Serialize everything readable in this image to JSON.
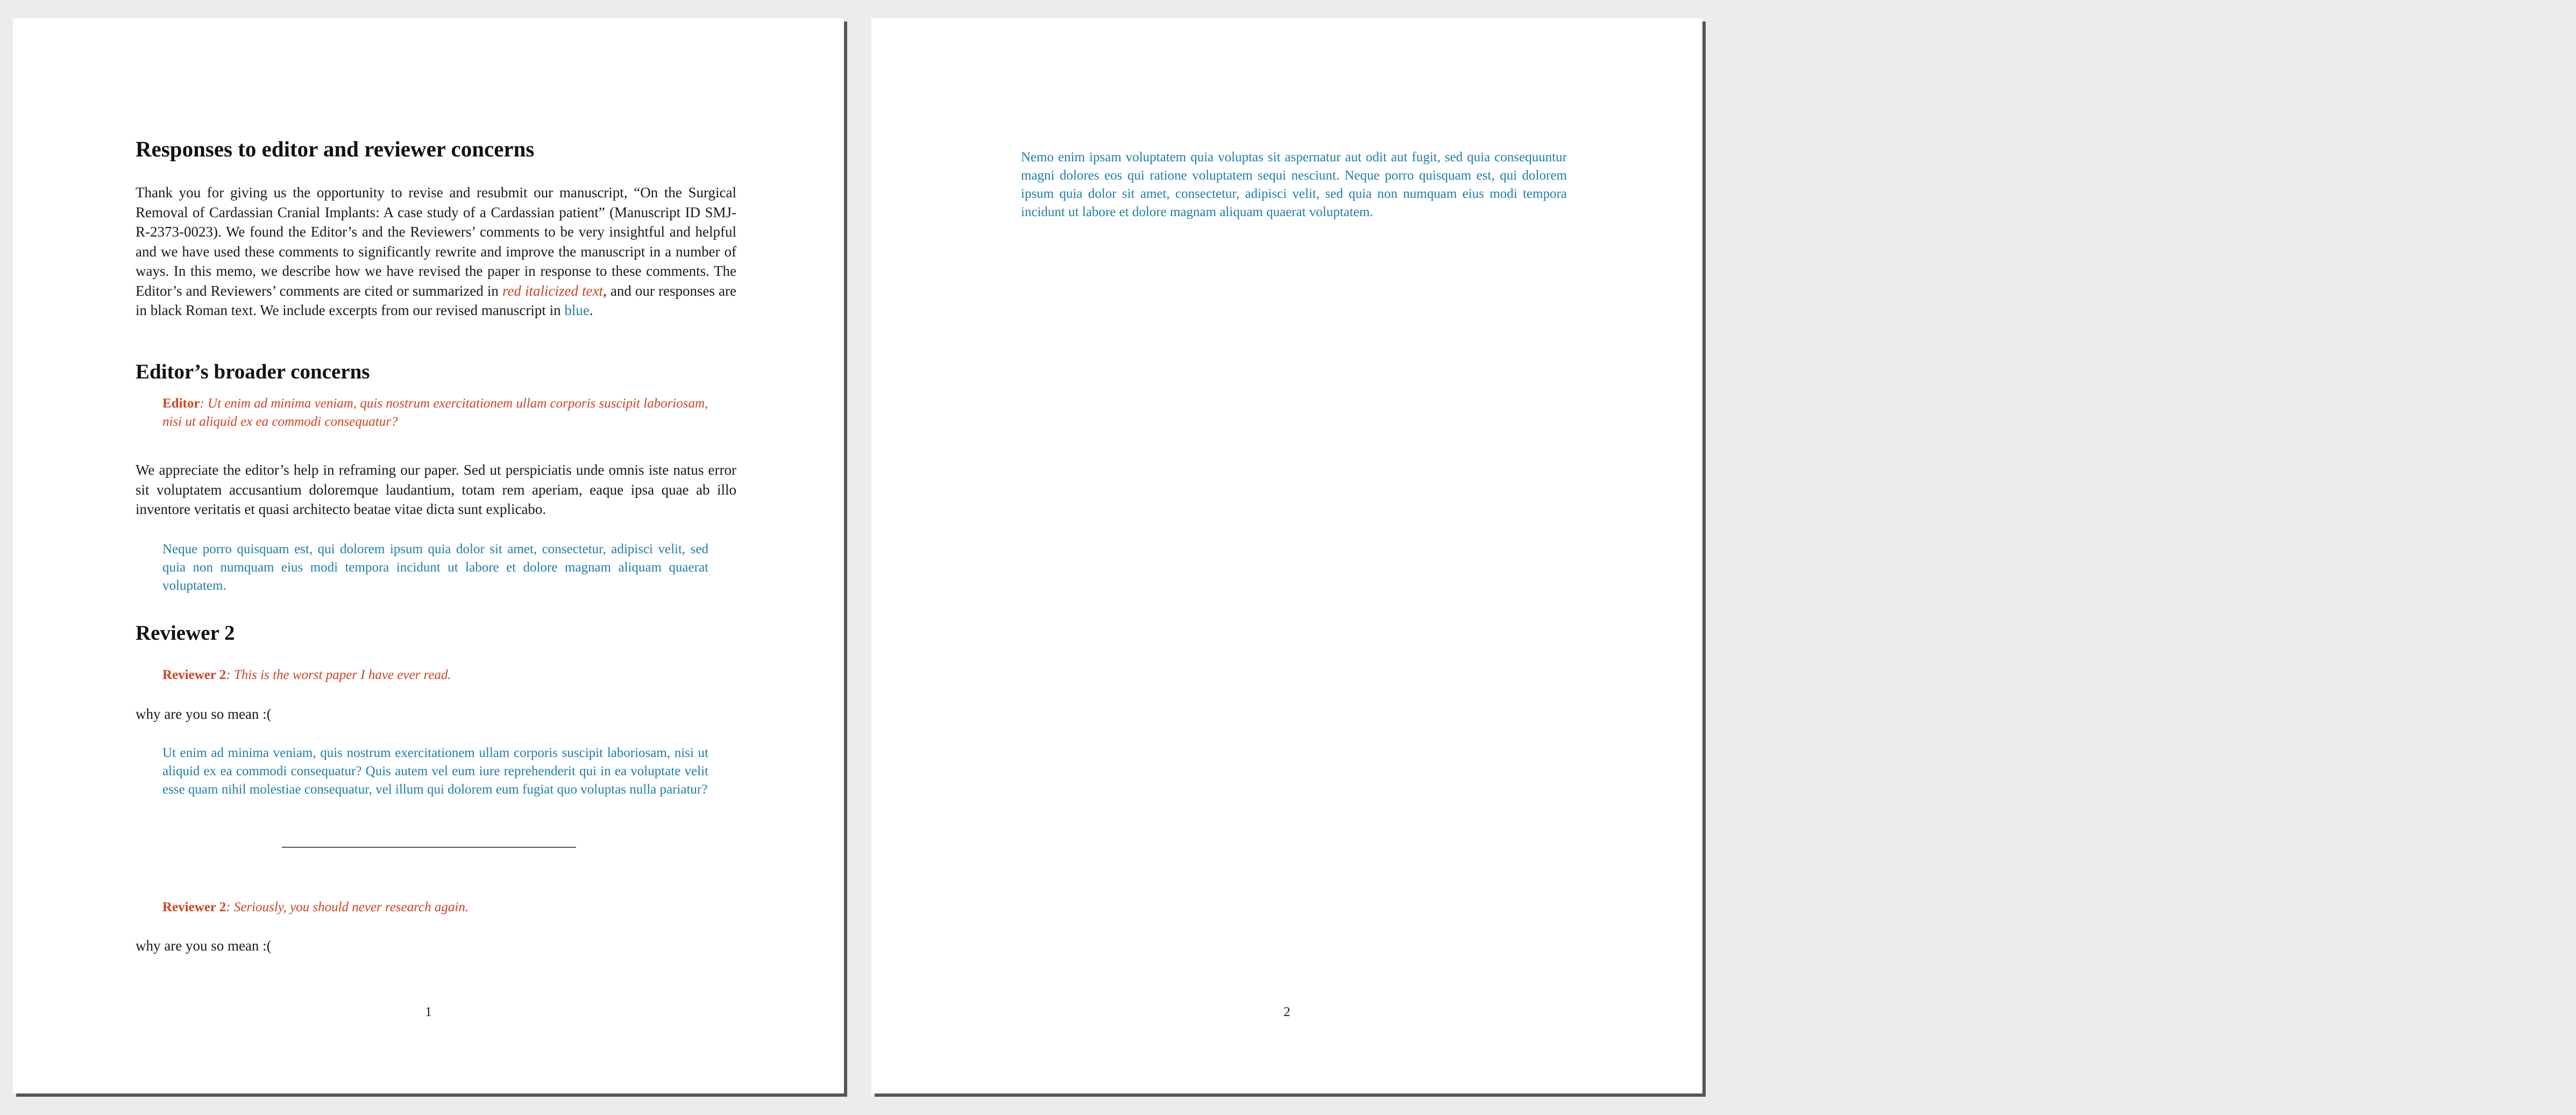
{
  "page1": {
    "title": "Responses to editor and reviewer concerns",
    "intro": {
      "part1": "Thank you for giving us the opportunity to revise and resubmit our manuscript, “On the Surgical Removal of Cardassian Cranial Implants: A case study of a Cardassian patient” (Manuscript ID SMJ-R-2373-0023). We found the Editor’s and the Reviewers’ comments to be very insightful and helpful and we have used these comments to significantly rewrite and improve the manuscript in a number of ways. In this memo, we describe how we have revised the paper in response to these comments. The Editor’s and Reviewers’ comments are cited or summarized in ",
      "red_text": "red italicized text",
      "part2": ", and our responses are in black Roman text. We include excerpts from our revised manuscript in ",
      "blue_text": "blue",
      "part3": "."
    },
    "section_editor": {
      "heading": "Editor’s broader concerns",
      "comment_label": "Editor",
      "comment_text": ": Ut enim ad minima veniam, quis nostrum exercitationem ullam corporis suscipit laboriosam, nisi ut aliquid ex ea commodi consequatur?",
      "response": "We appreciate the editor’s help in reframing our paper. Sed ut perspiciatis unde omnis iste natus error sit voluptatem accusantium doloremque laudantium, totam rem aperiam, eaque ipsa quae ab illo inventore veritatis et quasi architecto beatae vitae dicta sunt explicabo.",
      "excerpt": "Neque porro quisquam est, qui dolorem ipsum quia dolor sit amet, consectetur, adipisci velit, sed quia non numquam eius modi tempora incidunt ut labore et dolore magnam aliquam quaerat voluptatem."
    },
    "section_reviewer2": {
      "heading": "Reviewer 2",
      "comment1_label": "Reviewer 2",
      "comment1_text": ": This is the worst paper I have ever read.",
      "response1": "why are you so mean :(",
      "excerpt1": "Ut enim ad minima veniam, quis nostrum exercitationem ullam corporis suscipit laboriosam, nisi ut aliquid ex ea commodi consequatur? Quis autem vel eum iure reprehenderit qui in ea voluptate velit esse quam nihil molestiae consequatur, vel illum qui dolorem eum fugiat quo voluptas nulla pariatur?",
      "comment2_label": "Reviewer 2",
      "comment2_text": ": Seriously, you should never research again.",
      "response2": "why are you so mean :("
    },
    "page_number": "1"
  },
  "page2": {
    "excerpt": "Nemo enim ipsam voluptatem quia voluptas sit aspernatur aut odit aut fugit, sed quia consequuntur magni dolores eos qui ratione voluptatem sequi nesciunt. Neque porro quisquam est, qui dolorem ipsum quia dolor sit amet, consectetur, adipisci velit, sed quia non numquam eius modi tempora incidunt ut labore et dolore magnam aliquam quaerat voluptatem.",
    "page_number": "2"
  },
  "colors": {
    "comment_red": "#d2421f",
    "excerpt_blue": "#1f7ea8",
    "background": "#ececec",
    "page": "#ffffff"
  }
}
